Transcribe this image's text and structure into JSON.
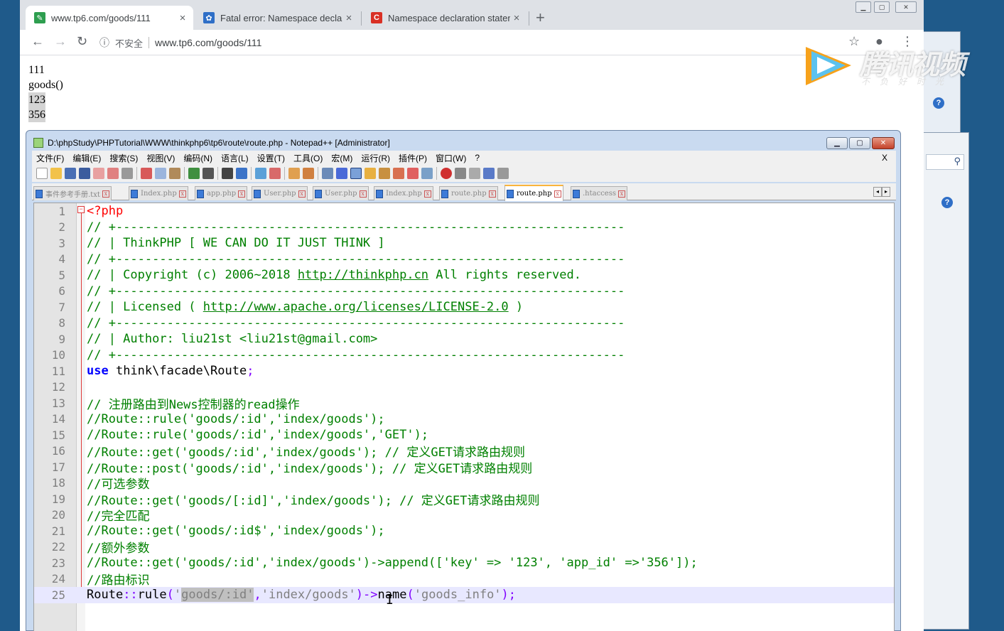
{
  "browser": {
    "tabs": [
      {
        "title": "www.tp6.com/goods/111",
        "active": true,
        "favicon": "sheet-icon",
        "color": "#2e9e4f"
      },
      {
        "title": "Fatal error: Namespace declar",
        "active": false,
        "favicon": "paw-icon",
        "color": "#2f6fc7"
      },
      {
        "title": "Namespace declaration staten",
        "active": false,
        "favicon": "csdn-icon",
        "color": "#d93025"
      }
    ],
    "new_tab": "+",
    "insecure_label": "不安全",
    "url": "www.tp6.com/goods/111",
    "page_lines": [
      "111",
      "goods()",
      "123",
      "356"
    ]
  },
  "watermark": {
    "brand": "腾讯视频",
    "slogan": "不负好时光"
  },
  "npp": {
    "title": "D:\\phpStudy\\PHPTutorial\\WWW\\thinkphp6\\tp6\\route\\route.php - Notepad++ [Administrator]",
    "menu": [
      "文件(F)",
      "编辑(E)",
      "搜索(S)",
      "视图(V)",
      "编码(N)",
      "语言(L)",
      "设置(T)",
      "工具(O)",
      "宏(M)",
      "运行(R)",
      "插件(P)",
      "窗口(W)",
      "?"
    ],
    "menu_close": "X",
    "doc_tabs": [
      {
        "label": "事件参考手册.txt",
        "active": false
      },
      {
        "label": "Index.php",
        "active": false
      },
      {
        "label": "app.php",
        "active": false
      },
      {
        "label": "User.php",
        "active": false
      },
      {
        "label": "User.php",
        "active": false
      },
      {
        "label": "Index.php",
        "active": false
      },
      {
        "label": "route.php",
        "active": false
      },
      {
        "label": "route.php",
        "active": true
      },
      {
        "label": ".htaccess",
        "active": false
      }
    ],
    "lines": [
      {
        "n": "1",
        "parts": [
          {
            "t": "<?php",
            "c": "php"
          }
        ]
      },
      {
        "n": "2",
        "parts": [
          {
            "t": "// +----------------------------------------------------------------------",
            "c": "cmt"
          }
        ]
      },
      {
        "n": "3",
        "parts": [
          {
            "t": "// | ThinkPHP [ WE CAN DO IT JUST THINK ]",
            "c": "cmt"
          }
        ]
      },
      {
        "n": "4",
        "parts": [
          {
            "t": "// +----------------------------------------------------------------------",
            "c": "cmt"
          }
        ]
      },
      {
        "n": "5",
        "parts": [
          {
            "t": "// | Copyright (c) 2006~2018 ",
            "c": "cmt"
          },
          {
            "t": "http://thinkphp.cn",
            "c": "url"
          },
          {
            "t": " All rights reserved.",
            "c": "cmt"
          }
        ]
      },
      {
        "n": "6",
        "parts": [
          {
            "t": "// +----------------------------------------------------------------------",
            "c": "cmt"
          }
        ]
      },
      {
        "n": "7",
        "parts": [
          {
            "t": "// | Licensed ( ",
            "c": "cmt"
          },
          {
            "t": "http://www.apache.org/licenses/LICENSE-2.0",
            "c": "url"
          },
          {
            "t": " )",
            "c": "cmt"
          }
        ]
      },
      {
        "n": "8",
        "parts": [
          {
            "t": "// +----------------------------------------------------------------------",
            "c": "cmt"
          }
        ]
      },
      {
        "n": "9",
        "parts": [
          {
            "t": "// | Author: liu21st <liu21st@gmail.com>",
            "c": "cmt"
          }
        ]
      },
      {
        "n": "10",
        "parts": [
          {
            "t": "// +----------------------------------------------------------------------",
            "c": "cmt"
          }
        ]
      },
      {
        "n": "11",
        "parts": [
          {
            "t": "use",
            "c": "kw"
          },
          {
            "t": " think\\facade\\Route",
            "c": "def"
          },
          {
            "t": ";",
            "c": "op"
          }
        ]
      },
      {
        "n": "12",
        "parts": []
      },
      {
        "n": "13",
        "parts": [
          {
            "t": "// 注册路由到News控制器的read操作",
            "c": "cmt"
          }
        ]
      },
      {
        "n": "14",
        "parts": [
          {
            "t": "//Route::rule('goods/:id','index/goods');",
            "c": "cmt"
          }
        ]
      },
      {
        "n": "15",
        "parts": [
          {
            "t": "//Route::rule('goods/:id','index/goods','GET');",
            "c": "cmt"
          }
        ]
      },
      {
        "n": "16",
        "parts": [
          {
            "t": "//Route::get('goods/:id','index/goods'); // 定义GET请求路由规则",
            "c": "cmt"
          }
        ]
      },
      {
        "n": "17",
        "parts": [
          {
            "t": "//Route::post('goods/:id','index/goods'); // 定义GET请求路由规则",
            "c": "cmt"
          }
        ]
      },
      {
        "n": "18",
        "parts": [
          {
            "t": "//可选参数",
            "c": "cmt"
          }
        ]
      },
      {
        "n": "19",
        "parts": [
          {
            "t": "//Route::get('goods/[:id]','index/goods'); // 定义GET请求路由规则",
            "c": "cmt"
          }
        ]
      },
      {
        "n": "20",
        "parts": [
          {
            "t": "//完全匹配",
            "c": "cmt"
          }
        ]
      },
      {
        "n": "21",
        "parts": [
          {
            "t": "//Route::get('goods/:id$','index/goods');",
            "c": "cmt"
          }
        ]
      },
      {
        "n": "22",
        "parts": [
          {
            "t": "//额外参数",
            "c": "cmt"
          }
        ]
      },
      {
        "n": "23",
        "parts": [
          {
            "t": "//Route::get('goods/:id','index/goods')->append(['key' => '123', 'app_id' =>'356']);",
            "c": "cmt"
          }
        ]
      },
      {
        "n": "24",
        "parts": [
          {
            "t": "//路由标识",
            "c": "cmt"
          }
        ]
      },
      {
        "n": "25",
        "parts": [
          {
            "t": "Route",
            "c": "def"
          },
          {
            "t": "::",
            "c": "op"
          },
          {
            "t": "rule",
            "c": "def"
          },
          {
            "t": "(",
            "c": "op"
          },
          {
            "t": "'",
            "c": "str"
          },
          {
            "t": "goods/:id'",
            "c": "str sel"
          },
          {
            "t": ",",
            "c": "op"
          },
          {
            "t": "'index/goods'",
            "c": "str"
          },
          {
            "t": ")->",
            "c": "op"
          },
          {
            "t": "name",
            "c": "def"
          },
          {
            "t": "(",
            "c": "op"
          },
          {
            "t": "'goods_info'",
            "c": "str"
          },
          {
            "t": ");",
            "c": "op"
          }
        ]
      }
    ],
    "current_line": "25"
  }
}
